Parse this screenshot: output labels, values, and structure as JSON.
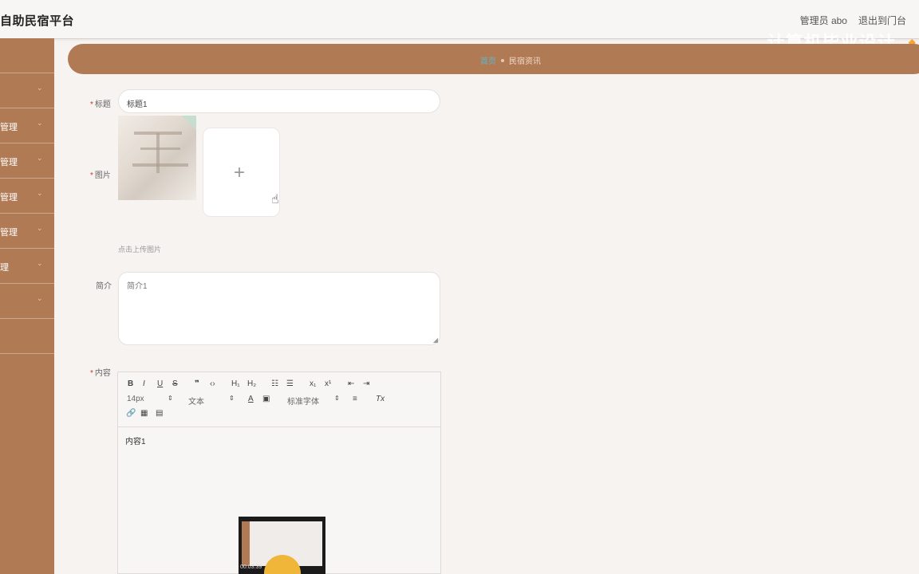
{
  "header": {
    "app_title": "自助民宿平台",
    "user_label": "管理员 abo",
    "exit_label": "退出到门台",
    "extra": "",
    "watermark": "计算机毕业设计 🔸"
  },
  "sidebar": {
    "items": [
      {
        "label": ""
      },
      {
        "label": ""
      },
      {
        "label": "管理"
      },
      {
        "label": "管理"
      },
      {
        "label": "管理"
      },
      {
        "label": "管理"
      },
      {
        "label": "理"
      },
      {
        "label": ""
      },
      {
        "label": ""
      }
    ]
  },
  "breadcrumb": {
    "home": "首页",
    "current": "民宿资讯"
  },
  "form": {
    "title_label": "标题",
    "title_value": "标题1",
    "image_label": "图片",
    "upload_hint": "点击上传图片",
    "intro_label": "简介",
    "intro_value": "简介1",
    "content_label": "内容",
    "content_value": "内容1"
  },
  "editor": {
    "font_size": "14px",
    "text_style": "文本",
    "font_family": "标准字体",
    "buttons": {
      "bold": "B",
      "italic": "I",
      "underline": "U",
      "strike": "S",
      "quote": "❞",
      "code": "‹›",
      "h1": "H₁",
      "h2": "H₂",
      "ol": "☷",
      "ul": "☰",
      "sub": "x₁",
      "sup": "x¹",
      "indent_out": "⇤",
      "indent_in": "⇥",
      "color": "A",
      "bg": "▣",
      "align": "≡",
      "clear": "Tx",
      "link": "🔗",
      "image": "▦",
      "video": "▤"
    }
  },
  "video_overlay": {
    "time": "00:03:39"
  }
}
